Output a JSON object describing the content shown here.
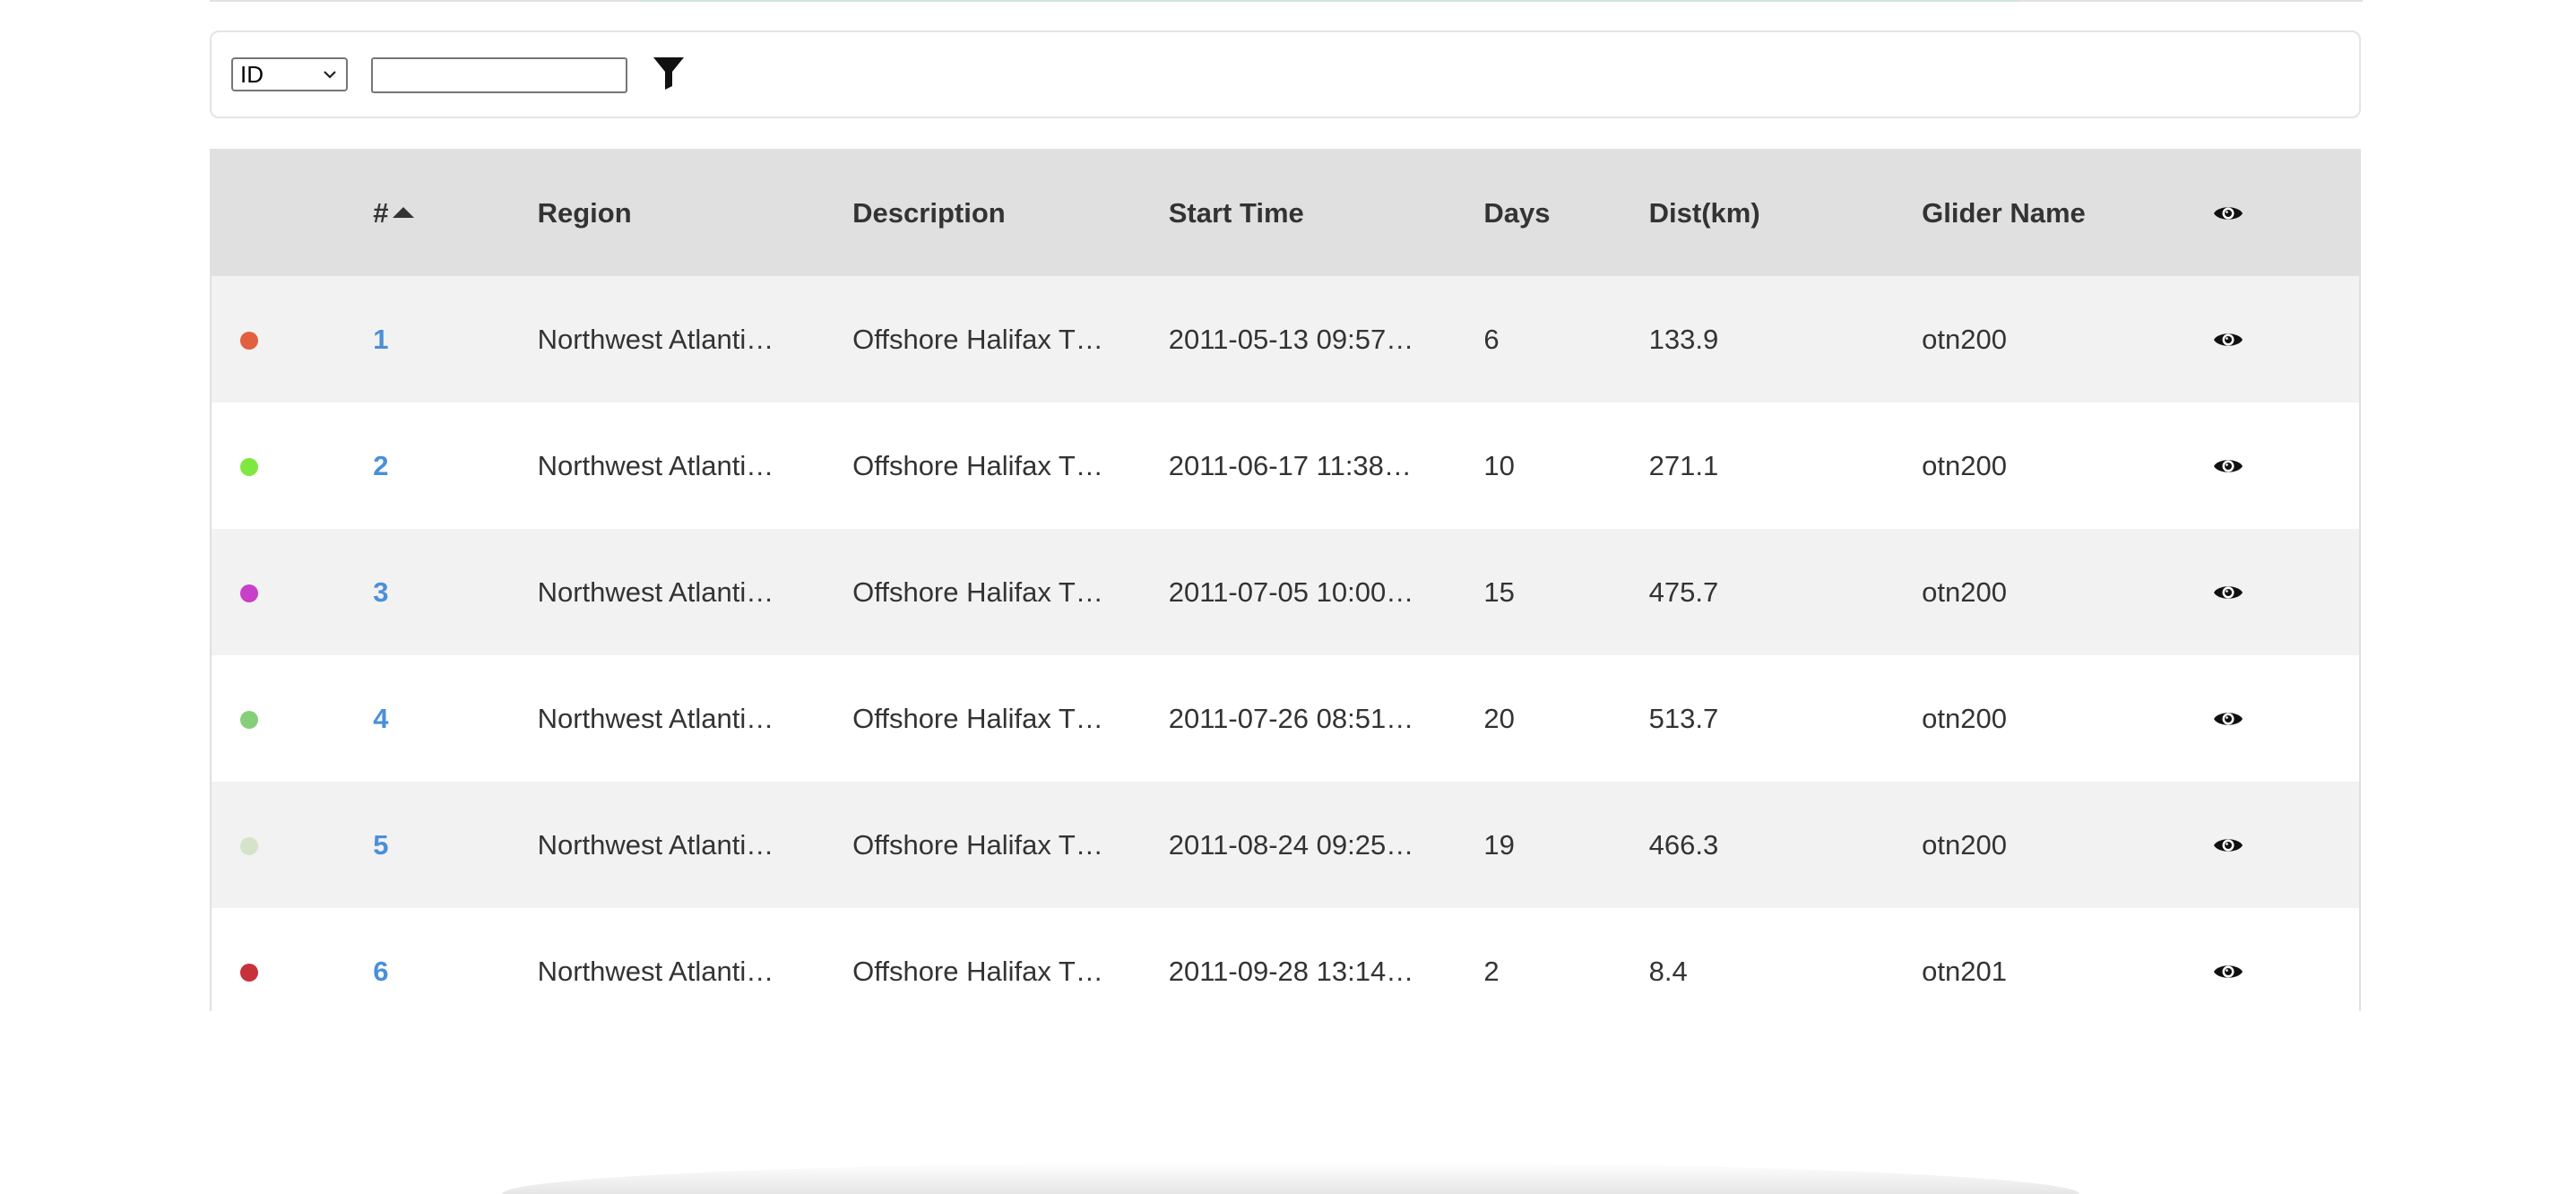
{
  "filter": {
    "field_selected": "ID",
    "search_value": "",
    "filter_icon": "filter-funnel-icon"
  },
  "table": {
    "columns": {
      "color": "",
      "id": "#",
      "region": "Region",
      "description": "Description",
      "start_time": "Start Time",
      "days": "Days",
      "dist": "Dist(km)",
      "glider": "Glider Name",
      "view_icon": "eye-icon"
    },
    "sort": {
      "column": "id",
      "direction": "ascending"
    },
    "rows": [
      {
        "color": "#e0603f",
        "id": "1",
        "region": "Northwest Atlanti…",
        "description": "Offshore Halifax T…",
        "start_time": "2011-05-13 09:57…",
        "days": "6",
        "dist": "133.9",
        "glider": "otn200"
      },
      {
        "color": "#7fe83f",
        "id": "2",
        "region": "Northwest Atlanti…",
        "description": "Offshore Halifax T…",
        "start_time": "2011-06-17 11:38…",
        "days": "10",
        "dist": "271.1",
        "glider": "otn200"
      },
      {
        "color": "#c83fc8",
        "id": "3",
        "region": "Northwest Atlanti…",
        "description": "Offshore Halifax T…",
        "start_time": "2011-07-05 10:00…",
        "days": "15",
        "dist": "475.7",
        "glider": "otn200"
      },
      {
        "color": "#86cf7a",
        "id": "4",
        "region": "Northwest Atlanti…",
        "description": "Offshore Halifax T…",
        "start_time": "2011-07-26 08:51…",
        "days": "20",
        "dist": "513.7",
        "glider": "otn200"
      },
      {
        "color": "#d6e3c8",
        "id": "5",
        "region": "Northwest Atlanti…",
        "description": "Offshore Halifax T…",
        "start_time": "2011-08-24 09:25…",
        "days": "19",
        "dist": "466.3",
        "glider": "otn200"
      },
      {
        "color": "#c8303a",
        "id": "6",
        "region": "Northwest Atlanti…",
        "description": "Offshore Halifax T…",
        "start_time": "2011-09-28 13:14…",
        "days": "2",
        "dist": "8.4",
        "glider": "otn201"
      }
    ]
  }
}
